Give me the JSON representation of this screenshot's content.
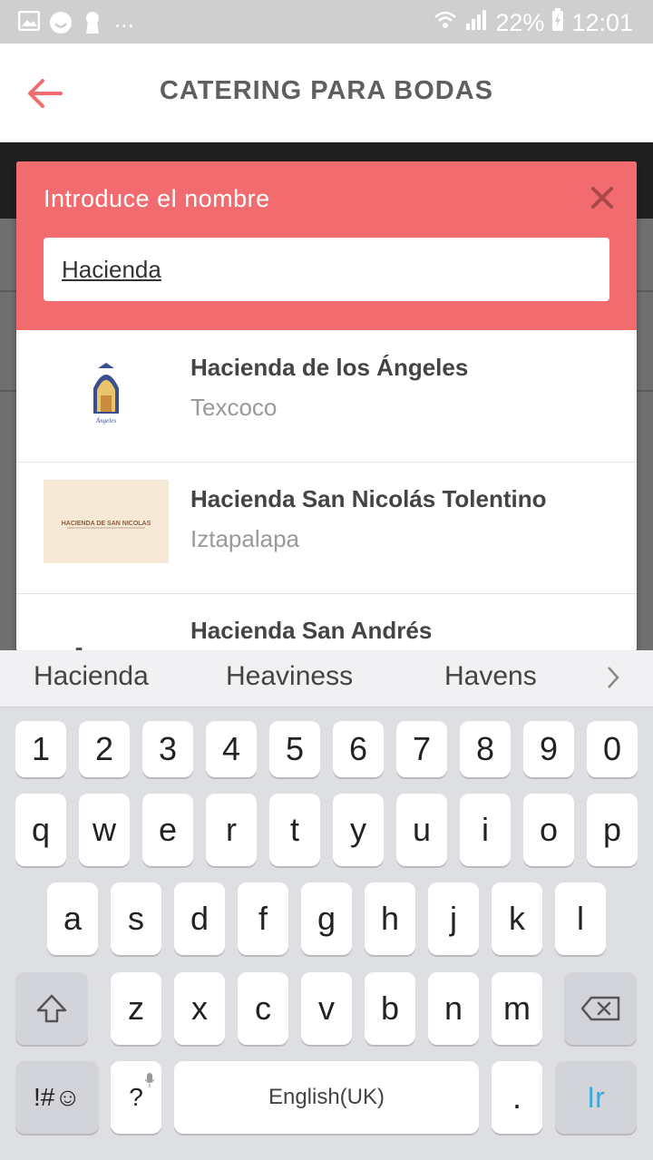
{
  "status_bar": {
    "battery": "22%",
    "time": "12:01",
    "more": "..."
  },
  "app_bar": {
    "title": "CATERING PARA BODAS"
  },
  "dialog": {
    "title": "Introduce el nombre",
    "search_value": "Hacienda",
    "results": [
      {
        "name": "Hacienda de los Ángeles",
        "location": "Texcoco"
      },
      {
        "name": "Hacienda San Nicolás Tolentino",
        "location": "Iztapalapa"
      },
      {
        "name": "Hacienda San Andrés",
        "location": ""
      }
    ],
    "thumb_text": "HACIENDA DE SAN NICOLAS"
  },
  "keyboard": {
    "suggestions": [
      "Hacienda",
      "Heaviness",
      "Havens"
    ],
    "row_numbers": [
      "1",
      "2",
      "3",
      "4",
      "5",
      "6",
      "7",
      "8",
      "9",
      "0"
    ],
    "row1": [
      "q",
      "w",
      "e",
      "r",
      "t",
      "y",
      "u",
      "i",
      "o",
      "p"
    ],
    "row2": [
      "a",
      "s",
      "d",
      "f",
      "g",
      "h",
      "j",
      "k",
      "l"
    ],
    "row3": [
      "z",
      "x",
      "c",
      "v",
      "b",
      "n",
      "m"
    ],
    "symbols_label": "!#☺",
    "question_label": "?",
    "space_label": "English(UK)",
    "period_label": ".",
    "enter_label": "Ir"
  },
  "colors": {
    "accent": "#f26c6f",
    "enter": "#3aa9d6"
  }
}
